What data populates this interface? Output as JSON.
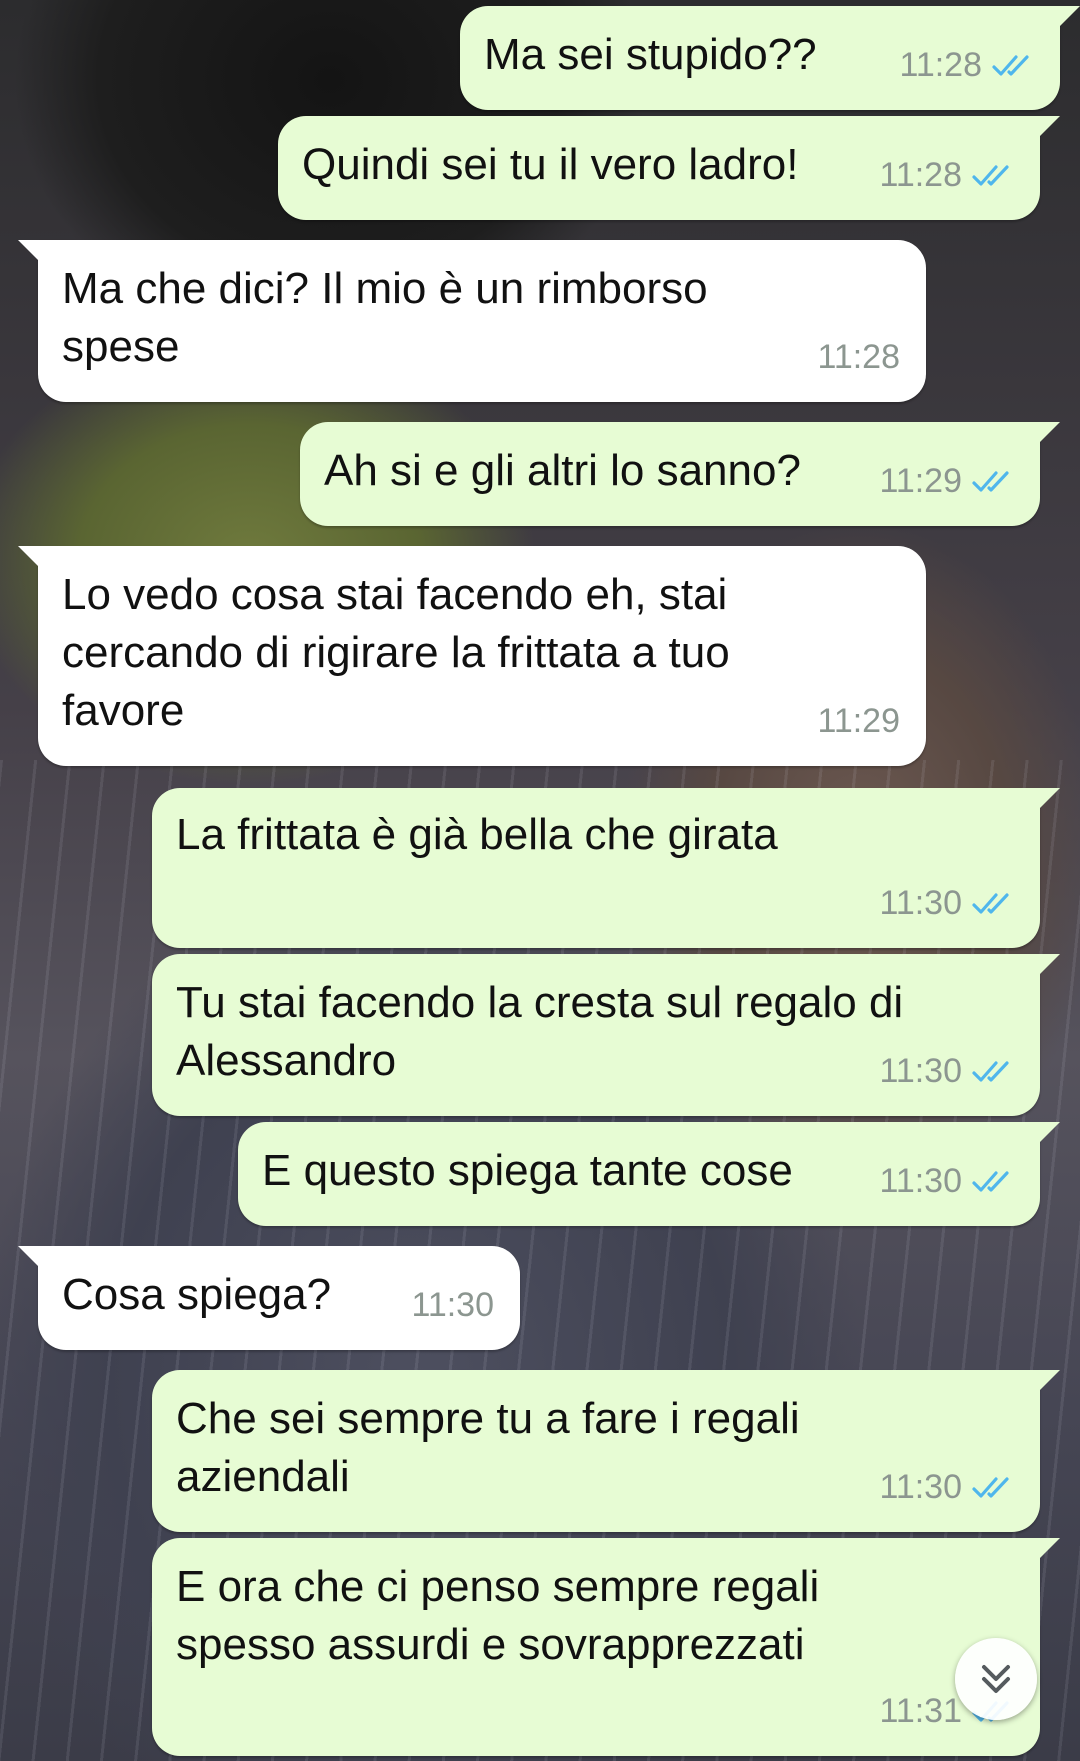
{
  "messages": [
    {
      "direction": "out",
      "text": "Ma sei stupido??",
      "time": "11:28",
      "read": true
    },
    {
      "direction": "out",
      "text": "Quindi sei tu il vero ladro!",
      "time": "11:28",
      "read": true
    },
    {
      "direction": "in",
      "text": "Ma che dici? Il mio è un rimborso\nspese",
      "time": "11:28"
    },
    {
      "direction": "out",
      "text": "Ah si e gli altri lo sanno?",
      "time": "11:29",
      "read": true
    },
    {
      "direction": "in",
      "text": "Lo vedo cosa stai facendo eh, stai\ncercando di rigirare la frittata a tuo\nfavore",
      "time": "11:29"
    },
    {
      "direction": "out",
      "text": "La frittata è già bella che girata",
      "time": "11:30",
      "read": true
    },
    {
      "direction": "out",
      "text": "Tu stai facendo la cresta sul regalo di\nAlessandro",
      "time": "11:30",
      "read": true
    },
    {
      "direction": "out",
      "text": "E questo spiega tante cose",
      "time": "11:30",
      "read": true
    },
    {
      "direction": "in",
      "text": "Cosa spiega?",
      "time": "11:30"
    },
    {
      "direction": "out",
      "text": "Che sei sempre tu a fare i regali\naziendali",
      "time": "11:30",
      "read": true
    },
    {
      "direction": "out",
      "text": "E ora che ci penso sempre regali\nspesso assurdi e sovrapprezzati",
      "time": "11:31",
      "read": true
    }
  ],
  "icons": {
    "read_receipt": "double-check-icon",
    "scroll_down": "chevron-double-down-icon"
  },
  "colors": {
    "outgoing_bubble": "#e7fcd4",
    "incoming_bubble": "#ffffff",
    "read_tick": "#4fb6ec",
    "timestamp": "#8c9690"
  }
}
